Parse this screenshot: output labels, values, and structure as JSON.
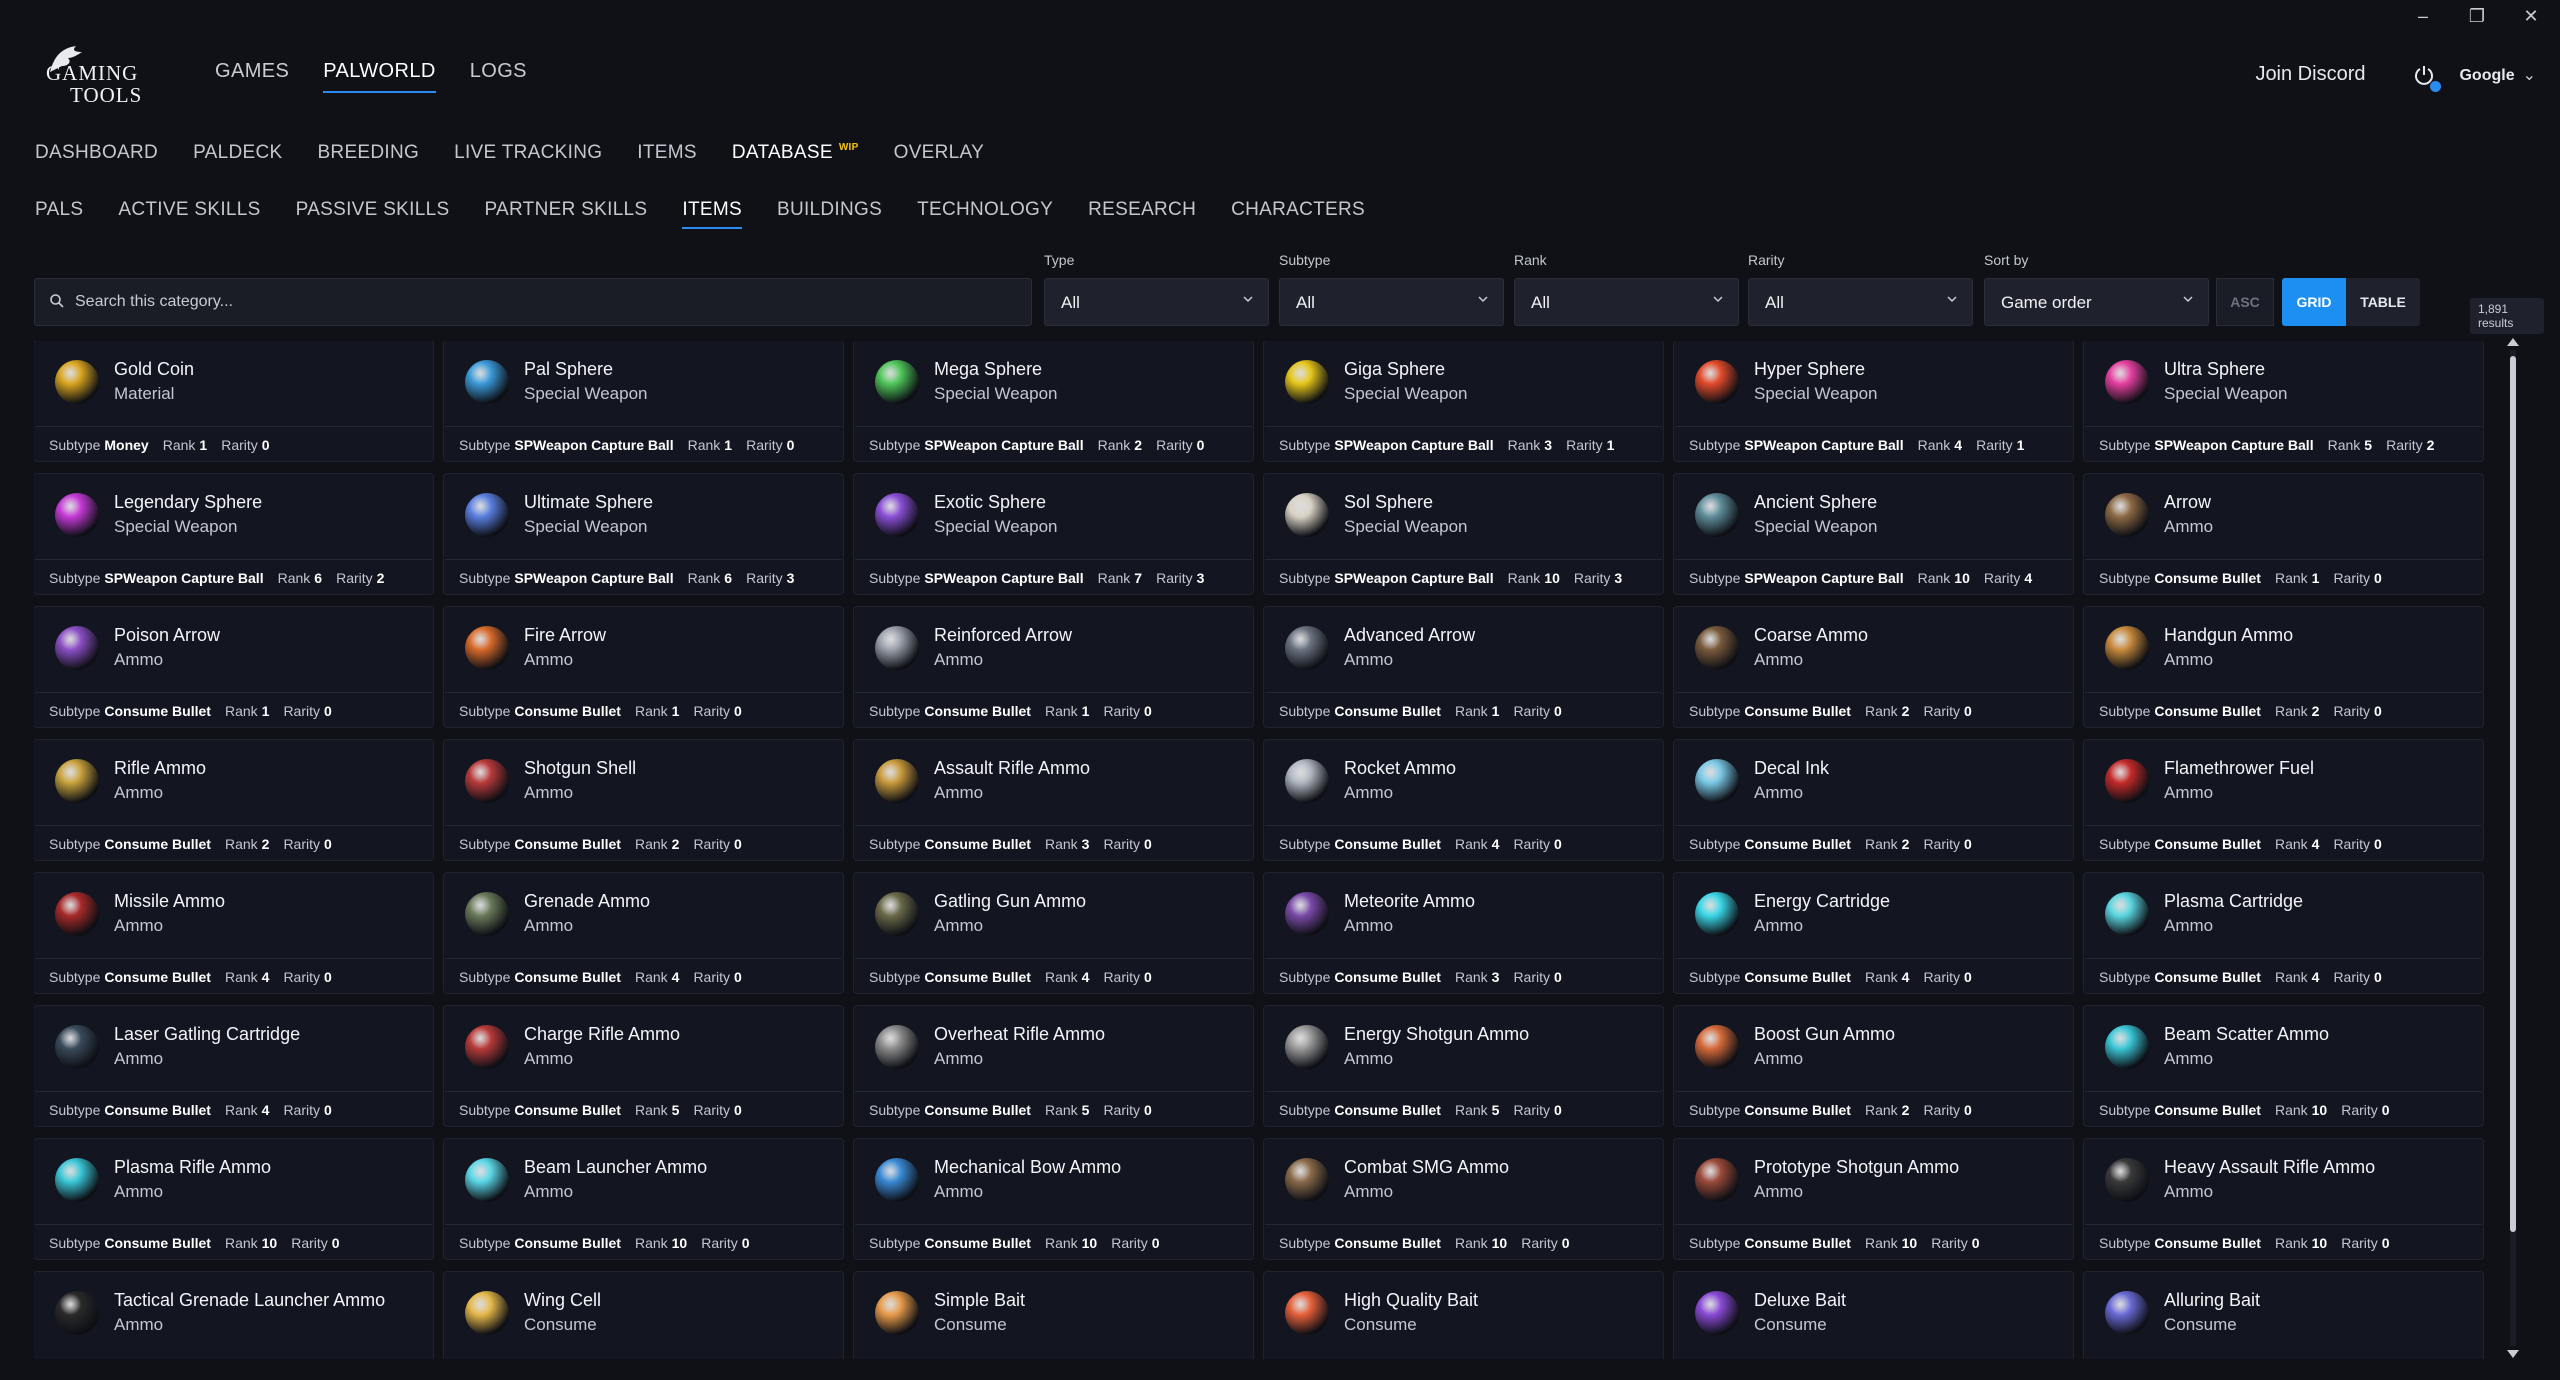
{
  "window_controls": {
    "minimize": "–",
    "restore": "❐",
    "close": "✕"
  },
  "app": {
    "logo_line1": "GAMING",
    "logo_line2": "TOOLS",
    "nav": [
      "GAMES",
      "PALWORLD",
      "LOGS"
    ],
    "active_nav": "PALWORLD",
    "discord": "Join Discord",
    "account": "Google",
    "account_chevron": "⌄"
  },
  "palworld_tabs": {
    "items": [
      "DASHBOARD",
      "PALDECK",
      "BREEDING",
      "LIVE TRACKING",
      "ITEMS",
      "DATABASE",
      "OVERLAY"
    ],
    "active": "DATABASE",
    "badge": "WIP"
  },
  "database_tabs": {
    "items": [
      "PALS",
      "ACTIVE SKILLS",
      "PASSIVE SKILLS",
      "PARTNER SKILLS",
      "ITEMS",
      "BUILDINGS",
      "TECHNOLOGY",
      "RESEARCH",
      "CHARACTERS"
    ],
    "active": "ITEMS"
  },
  "filters": {
    "search_placeholder": "Search this category...",
    "type": {
      "label": "Type",
      "value": "All"
    },
    "subtype": {
      "label": "Subtype",
      "value": "All"
    },
    "rank": {
      "label": "Rank",
      "value": "All"
    },
    "rarity": {
      "label": "Rarity",
      "value": "All"
    },
    "sort": {
      "label": "Sort by",
      "value": "Game order"
    },
    "asc": "ASC",
    "grid": "GRID",
    "table": "TABLE",
    "results": "1,891 results"
  },
  "meta_labels": {
    "subtype": "Subtype",
    "rank": "Rank",
    "rarity": "Rarity"
  },
  "items": [
    {
      "name": "Gold Coin",
      "category": "Material",
      "subtype": "Money",
      "rank": "1",
      "rarity": "0",
      "icon": "gold-coin-icon",
      "color": "#d9a520"
    },
    {
      "name": "Pal Sphere",
      "category": "Special Weapon",
      "subtype": "SPWeapon Capture Ball",
      "rank": "1",
      "rarity": "0",
      "icon": "pal-sphere-icon",
      "color": "#3b9ad9"
    },
    {
      "name": "Mega Sphere",
      "category": "Special Weapon",
      "subtype": "SPWeapon Capture Ball",
      "rank": "2",
      "rarity": "0",
      "icon": "mega-sphere-icon",
      "color": "#4fc65a"
    },
    {
      "name": "Giga Sphere",
      "category": "Special Weapon",
      "subtype": "SPWeapon Capture Ball",
      "rank": "3",
      "rarity": "1",
      "icon": "giga-sphere-icon",
      "color": "#e6c619"
    },
    {
      "name": "Hyper Sphere",
      "category": "Special Weapon",
      "subtype": "SPWeapon Capture Ball",
      "rank": "4",
      "rarity": "1",
      "icon": "hyper-sphere-icon",
      "color": "#e24a2a"
    },
    {
      "name": "Ultra Sphere",
      "category": "Special Weapon",
      "subtype": "SPWeapon Capture Ball",
      "rank": "5",
      "rarity": "2",
      "icon": "ultra-sphere-icon",
      "color": "#e640a0"
    },
    {
      "name": "Legendary Sphere",
      "category": "Special Weapon",
      "subtype": "SPWeapon Capture Ball",
      "rank": "6",
      "rarity": "2",
      "icon": "legendary-sphere-icon",
      "color": "#c43ad6"
    },
    {
      "name": "Ultimate Sphere",
      "category": "Special Weapon",
      "subtype": "SPWeapon Capture Ball",
      "rank": "6",
      "rarity": "3",
      "icon": "ultimate-sphere-icon",
      "color": "#5a7fe0"
    },
    {
      "name": "Exotic Sphere",
      "category": "Special Weapon",
      "subtype": "SPWeapon Capture Ball",
      "rank": "7",
      "rarity": "3",
      "icon": "exotic-sphere-icon",
      "color": "#8a4fd6"
    },
    {
      "name": "Sol Sphere",
      "category": "Special Weapon",
      "subtype": "SPWeapon Capture Ball",
      "rank": "10",
      "rarity": "3",
      "icon": "sol-sphere-icon",
      "color": "#d8d2c4"
    },
    {
      "name": "Ancient Sphere",
      "category": "Special Weapon",
      "subtype": "SPWeapon Capture Ball",
      "rank": "10",
      "rarity": "4",
      "icon": "ancient-sphere-icon",
      "color": "#5f8d9a"
    },
    {
      "name": "Arrow",
      "category": "Ammo",
      "subtype": "Consume Bullet",
      "rank": "1",
      "rarity": "0",
      "icon": "arrow-icon",
      "color": "#8d6a45"
    },
    {
      "name": "Poison Arrow",
      "category": "Ammo",
      "subtype": "Consume Bullet",
      "rank": "1",
      "rarity": "0",
      "icon": "poison-arrow-icon",
      "color": "#8b4fc4"
    },
    {
      "name": "Fire Arrow",
      "category": "Ammo",
      "subtype": "Consume Bullet",
      "rank": "1",
      "rarity": "0",
      "icon": "fire-arrow-icon",
      "color": "#d86a2a"
    },
    {
      "name": "Reinforced Arrow",
      "category": "Ammo",
      "subtype": "Consume Bullet",
      "rank": "1",
      "rarity": "0",
      "icon": "reinforced-arrow-icon",
      "color": "#9aa0aa"
    },
    {
      "name": "Advanced Arrow",
      "category": "Ammo",
      "subtype": "Consume Bullet",
      "rank": "1",
      "rarity": "0",
      "icon": "advanced-arrow-icon",
      "color": "#6b7280"
    },
    {
      "name": "Coarse Ammo",
      "category": "Ammo",
      "subtype": "Consume Bullet",
      "rank": "2",
      "rarity": "0",
      "icon": "coarse-ammo-icon",
      "color": "#7a5a3c"
    },
    {
      "name": "Handgun Ammo",
      "category": "Ammo",
      "subtype": "Consume Bullet",
      "rank": "2",
      "rarity": "0",
      "icon": "handgun-ammo-icon",
      "color": "#c98a3c"
    },
    {
      "name": "Rifle Ammo",
      "category": "Ammo",
      "subtype": "Consume Bullet",
      "rank": "2",
      "rarity": "0",
      "icon": "rifle-ammo-icon",
      "color": "#c9a23c"
    },
    {
      "name": "Shotgun Shell",
      "category": "Ammo",
      "subtype": "Consume Bullet",
      "rank": "2",
      "rarity": "0",
      "icon": "shotgun-shell-icon",
      "color": "#b83a3a"
    },
    {
      "name": "Assault Rifle Ammo",
      "category": "Ammo",
      "subtype": "Consume Bullet",
      "rank": "3",
      "rarity": "0",
      "icon": "assault-rifle-ammo-icon",
      "color": "#c99a3c"
    },
    {
      "name": "Rocket Ammo",
      "category": "Ammo",
      "subtype": "Consume Bullet",
      "rank": "4",
      "rarity": "0",
      "icon": "rocket-ammo-icon",
      "color": "#b0b6c0"
    },
    {
      "name": "Decal Ink",
      "category": "Ammo",
      "subtype": "Consume Bullet",
      "rank": "2",
      "rarity": "0",
      "icon": "decal-ink-icon",
      "color": "#7ac8e6"
    },
    {
      "name": "Flamethrower Fuel",
      "category": "Ammo",
      "subtype": "Consume Bullet",
      "rank": "4",
      "rarity": "0",
      "icon": "flamethrower-fuel-icon",
      "color": "#c42a2a"
    },
    {
      "name": "Missile Ammo",
      "category": "Ammo",
      "subtype": "Consume Bullet",
      "rank": "4",
      "rarity": "0",
      "icon": "missile-ammo-icon",
      "color": "#a82a2a"
    },
    {
      "name": "Grenade Ammo",
      "category": "Ammo",
      "subtype": "Consume Bullet",
      "rank": "4",
      "rarity": "0",
      "icon": "grenade-ammo-icon",
      "color": "#6a7a5a"
    },
    {
      "name": "Gatling Gun Ammo",
      "category": "Ammo",
      "subtype": "Consume Bullet",
      "rank": "4",
      "rarity": "0",
      "icon": "gatling-gun-ammo-icon",
      "color": "#6a6a4a"
    },
    {
      "name": "Meteorite Ammo",
      "category": "Ammo",
      "subtype": "Consume Bullet",
      "rank": "3",
      "rarity": "0",
      "icon": "meteorite-ammo-icon",
      "color": "#7a4aa8"
    },
    {
      "name": "Energy Cartridge",
      "category": "Ammo",
      "subtype": "Consume Bullet",
      "rank": "4",
      "rarity": "0",
      "icon": "energy-cartridge-icon",
      "color": "#3ad6e6"
    },
    {
      "name": "Plasma Cartridge",
      "category": "Ammo",
      "subtype": "Consume Bullet",
      "rank": "4",
      "rarity": "0",
      "icon": "plasma-cartridge-icon",
      "color": "#5ad6e0"
    },
    {
      "name": "Laser Gatling Cartridge",
      "category": "Ammo",
      "subtype": "Consume Bullet",
      "rank": "4",
      "rarity": "0",
      "icon": "laser-gatling-cartridge-icon",
      "color": "#3a4a5a"
    },
    {
      "name": "Charge Rifle Ammo",
      "category": "Ammo",
      "subtype": "Consume Bullet",
      "rank": "5",
      "rarity": "0",
      "icon": "charge-rifle-ammo-icon",
      "color": "#b83a3a"
    },
    {
      "name": "Overheat Rifle Ammo",
      "category": "Ammo",
      "subtype": "Consume Bullet",
      "rank": "5",
      "rarity": "0",
      "icon": "overheat-rifle-ammo-icon",
      "color": "#8a8a8a"
    },
    {
      "name": "Energy Shotgun Ammo",
      "category": "Ammo",
      "subtype": "Consume Bullet",
      "rank": "5",
      "rarity": "0",
      "icon": "energy-shotgun-ammo-icon",
      "color": "#9a9a9a"
    },
    {
      "name": "Boost Gun Ammo",
      "category": "Ammo",
      "subtype": "Consume Bullet",
      "rank": "2",
      "rarity": "0",
      "icon": "boost-gun-ammo-icon",
      "color": "#d66a3a"
    },
    {
      "name": "Beam Scatter Ammo",
      "category": "Ammo",
      "subtype": "Consume Bullet",
      "rank": "10",
      "rarity": "0",
      "icon": "beam-scatter-ammo-icon",
      "color": "#3ac6d6"
    },
    {
      "name": "Plasma Rifle Ammo",
      "category": "Ammo",
      "subtype": "Consume Bullet",
      "rank": "10",
      "rarity": "0",
      "icon": "plasma-rifle-ammo-icon",
      "color": "#3ac6d6"
    },
    {
      "name": "Beam Launcher Ammo",
      "category": "Ammo",
      "subtype": "Consume Bullet",
      "rank": "10",
      "rarity": "0",
      "icon": "beam-launcher-ammo-icon",
      "color": "#5ad6e6"
    },
    {
      "name": "Mechanical Bow Ammo",
      "category": "Ammo",
      "subtype": "Consume Bullet",
      "rank": "10",
      "rarity": "0",
      "icon": "mechanical-bow-ammo-icon",
      "color": "#3a8ad6"
    },
    {
      "name": "Combat SMG Ammo",
      "category": "Ammo",
      "subtype": "Consume Bullet",
      "rank": "10",
      "rarity": "0",
      "icon": "combat-smg-ammo-icon",
      "color": "#8a6a4a"
    },
    {
      "name": "Prototype Shotgun Ammo",
      "category": "Ammo",
      "subtype": "Consume Bullet",
      "rank": "10",
      "rarity": "0",
      "icon": "prototype-shotgun-ammo-icon",
      "color": "#9a4a3a"
    },
    {
      "name": "Heavy Assault Rifle Ammo",
      "category": "Ammo",
      "subtype": "Consume Bullet",
      "rank": "10",
      "rarity": "0",
      "icon": "heavy-assault-rifle-ammo-icon",
      "color": "#3a3a3a"
    },
    {
      "name": "Tactical Grenade Launcher Ammo",
      "category": "Ammo",
      "subtype": "",
      "rank": "",
      "rarity": "",
      "icon": "tactical-grenade-launcher-ammo-icon",
      "color": "#2a2a2a"
    },
    {
      "name": "Wing Cell",
      "category": "Consume",
      "subtype": "",
      "rank": "",
      "rarity": "",
      "icon": "wing-cell-icon",
      "color": "#e6b84a"
    },
    {
      "name": "Simple Bait",
      "category": "Consume",
      "subtype": "",
      "rank": "",
      "rarity": "",
      "icon": "simple-bait-icon",
      "color": "#e69a4a"
    },
    {
      "name": "High Quality Bait",
      "category": "Consume",
      "subtype": "",
      "rank": "",
      "rarity": "",
      "icon": "high-quality-bait-icon",
      "color": "#e6603a"
    },
    {
      "name": "Deluxe Bait",
      "category": "Consume",
      "subtype": "",
      "rank": "",
      "rarity": "",
      "icon": "deluxe-bait-icon",
      "color": "#8a4ad6"
    },
    {
      "name": "Alluring Bait",
      "category": "Consume",
      "subtype": "",
      "rank": "",
      "rarity": "",
      "icon": "alluring-bait-icon",
      "color": "#6a6ad6"
    }
  ]
}
